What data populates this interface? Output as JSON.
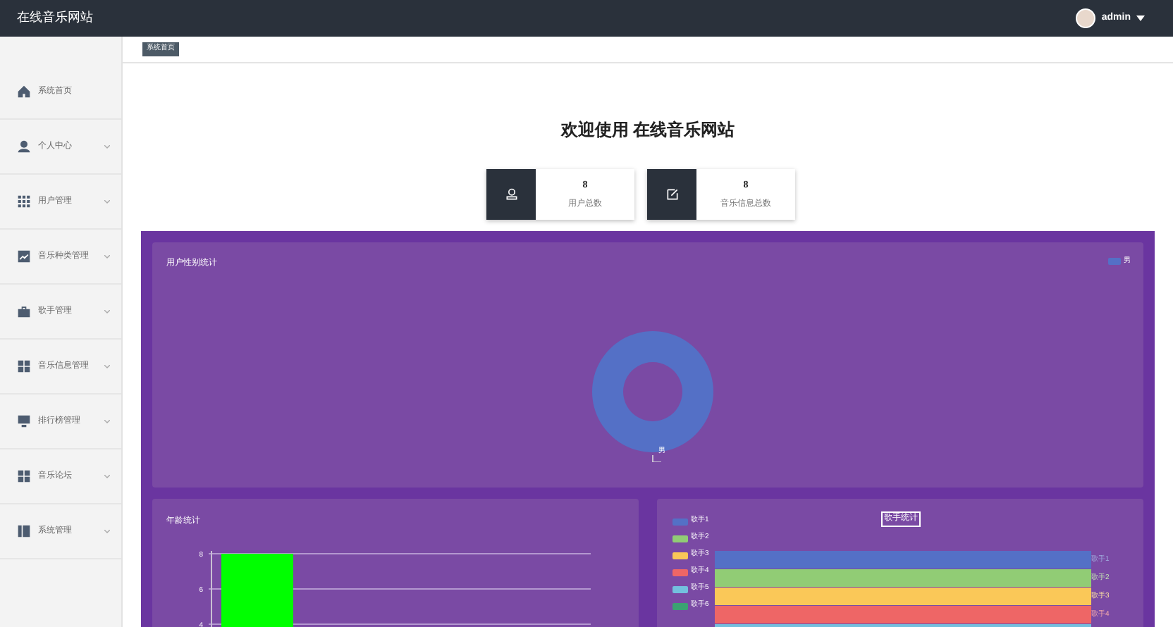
{
  "header": {
    "site_title": "在线音乐网站",
    "user": "admin"
  },
  "sidebar": {
    "items": [
      {
        "label": "系统首页",
        "expandable": false
      },
      {
        "label": "个人中心",
        "expandable": true
      },
      {
        "label": "用户管理",
        "expandable": true
      },
      {
        "label": "音乐种类管理",
        "expandable": true
      },
      {
        "label": "歌手管理",
        "expandable": true
      },
      {
        "label": "音乐信息管理",
        "expandable": true
      },
      {
        "label": "排行榜管理",
        "expandable": true
      },
      {
        "label": "音乐论坛",
        "expandable": true
      },
      {
        "label": "系统管理",
        "expandable": true
      }
    ]
  },
  "breadcrumb": "系统首页",
  "welcome": "欢迎使用 在线音乐网站",
  "stats": [
    {
      "value": "8",
      "label": "用户总数"
    },
    {
      "value": "8",
      "label": "音乐信息总数"
    }
  ],
  "gender_chart": {
    "title": "用户性别统计",
    "legend": [
      {
        "label": "男",
        "color": "#5470c6"
      }
    ],
    "slice_label": "男"
  },
  "age_chart": {
    "title": "年龄统计",
    "chart_data": {
      "type": "bar",
      "series": [
        {
          "color": "#00ff00",
          "values": [
            8
          ]
        }
      ],
      "ylim": [
        3.12,
        8.16
      ],
      "yticks": [
        {
          "value": 4,
          "label": "4"
        },
        {
          "value": 6,
          "label": "6"
        },
        {
          "value": 8,
          "label": "8"
        }
      ]
    }
  },
  "singer_chart": {
    "title": "歌手统计",
    "legend": [
      {
        "label": "歌手1",
        "color": "#5470c6"
      },
      {
        "label": "歌手2",
        "color": "#91cc75"
      },
      {
        "label": "歌手3",
        "color": "#fac858"
      },
      {
        "label": "歌手4",
        "color": "#ee6666"
      },
      {
        "label": "歌手5",
        "color": "#73c0de"
      },
      {
        "label": "歌手6",
        "color": "#3ba272"
      }
    ],
    "side_labels": [
      "歌手1",
      "歌手2",
      "歌手3",
      "歌手4"
    ]
  }
}
